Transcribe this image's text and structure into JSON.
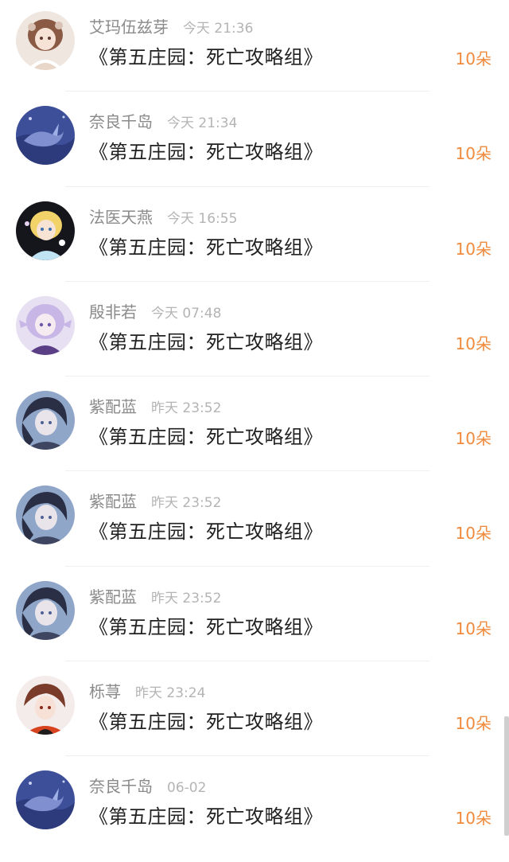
{
  "rows": [
    {
      "name": "艾玛伍兹芽",
      "time": "今天 21:36",
      "title": "《第五庄园：死亡攻略组》",
      "gift": "10朵",
      "avatar": "avatar-girl-light"
    },
    {
      "name": "奈良千岛",
      "time": "今天 21:34",
      "title": "《第五庄园：死亡攻略组》",
      "gift": "10朵",
      "avatar": "avatar-blue-whale"
    },
    {
      "name": "法医天燕",
      "time": "今天 16:55",
      "title": "《第五庄园：死亡攻略组》",
      "gift": "10朵",
      "avatar": "avatar-blonde-dark"
    },
    {
      "name": "殷非若",
      "time": "今天 07:48",
      "title": "《第五庄园：死亡攻略组》",
      "gift": "10朵",
      "avatar": "avatar-lavender-girl"
    },
    {
      "name": "紫配蓝",
      "time": "昨天 23:52",
      "title": "《第五庄园：死亡攻略组》",
      "gift": "10朵",
      "avatar": "avatar-dark-blue-boy"
    },
    {
      "name": "紫配蓝",
      "time": "昨天 23:52",
      "title": "《第五庄园：死亡攻略组》",
      "gift": "10朵",
      "avatar": "avatar-dark-blue-boy"
    },
    {
      "name": "紫配蓝",
      "time": "昨天 23:52",
      "title": "《第五庄园：死亡攻略组》",
      "gift": "10朵",
      "avatar": "avatar-dark-blue-boy"
    },
    {
      "name": "栎荨",
      "time": "昨天 23:24",
      "title": "《第五庄园：死亡攻略组》",
      "gift": "10朵",
      "avatar": "avatar-red-boy"
    },
    {
      "name": "奈良千岛",
      "time": "06-02",
      "title": "《第五庄园：死亡攻略组》",
      "gift": "10朵",
      "avatar": "avatar-blue-whale"
    }
  ],
  "colors": {
    "gift": "#f08a3c",
    "name": "#8a8a8a",
    "time": "#b4b4b4",
    "title": "#222222"
  }
}
